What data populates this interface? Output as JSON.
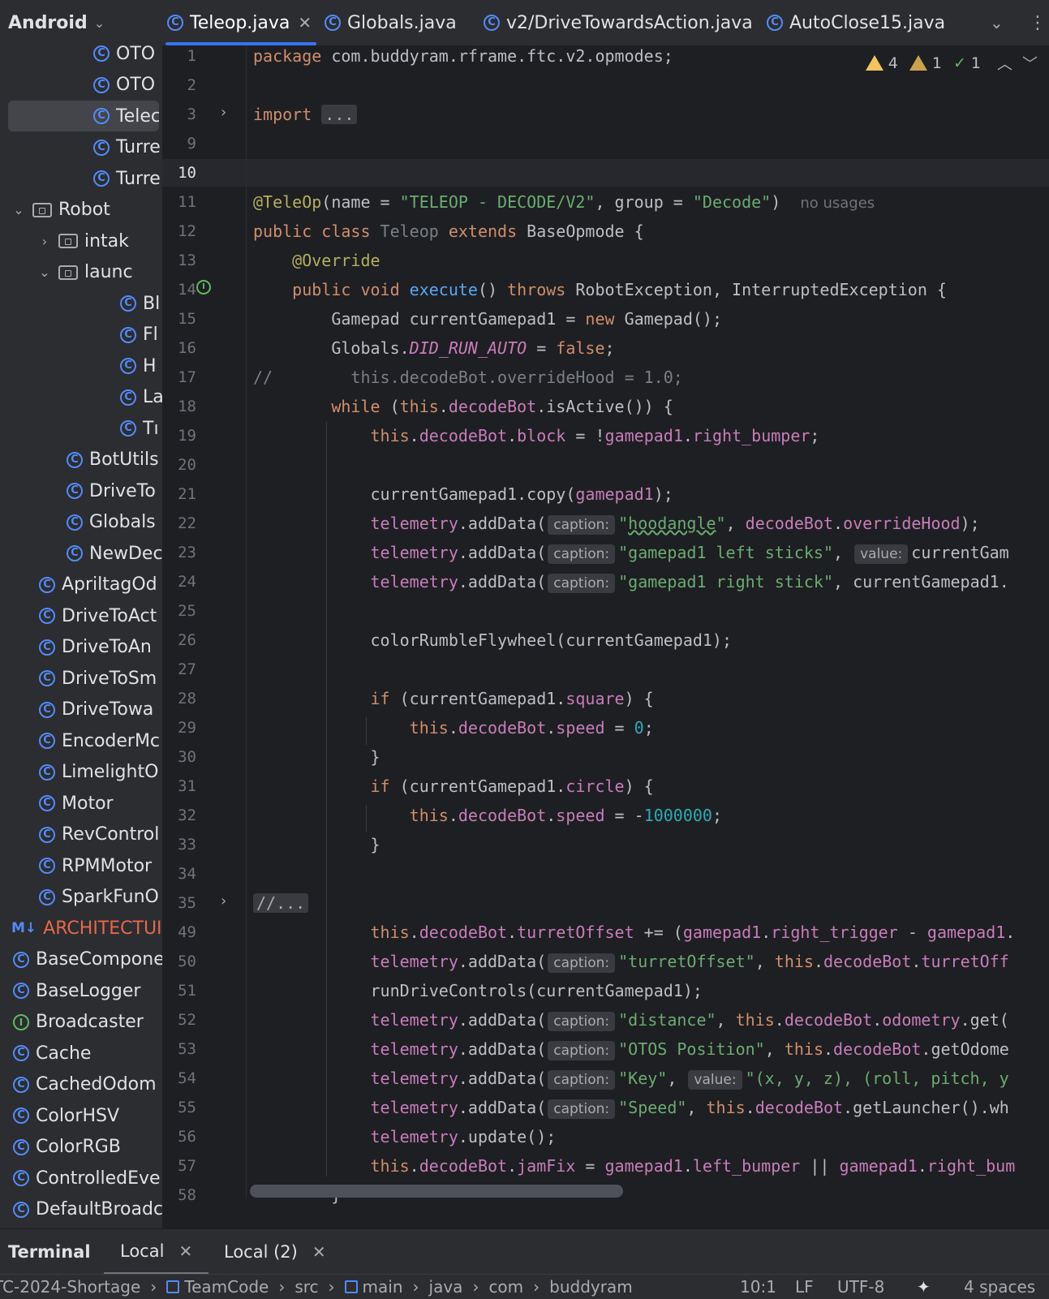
{
  "project_view": {
    "title": "Android",
    "items": [
      {
        "kind": "class",
        "label": "OTO",
        "indent": 115,
        "arrow": ""
      },
      {
        "kind": "class",
        "label": "OTO",
        "indent": 115,
        "arrow": ""
      },
      {
        "kind": "class",
        "label": "Telec",
        "indent": 115,
        "arrow": "",
        "selected": true
      },
      {
        "kind": "class",
        "label": "Turre",
        "indent": 115,
        "arrow": ""
      },
      {
        "kind": "class",
        "label": "Turre",
        "indent": 115,
        "arrow": ""
      },
      {
        "kind": "folder",
        "label": "Robot",
        "indent": 48,
        "arrow": "⌄"
      },
      {
        "kind": "folder",
        "label": "intak",
        "indent": 80,
        "arrow": "›"
      },
      {
        "kind": "folder",
        "label": "launc",
        "indent": 80,
        "arrow": "⌄"
      },
      {
        "kind": "class",
        "label": "Bl",
        "indent": 148,
        "arrow": ""
      },
      {
        "kind": "class",
        "label": "Fl",
        "indent": 148,
        "arrow": ""
      },
      {
        "kind": "class",
        "label": "H",
        "indent": 148,
        "arrow": ""
      },
      {
        "kind": "class",
        "label": "La",
        "indent": 148,
        "arrow": ""
      },
      {
        "kind": "class",
        "label": "Tı",
        "indent": 148,
        "arrow": ""
      },
      {
        "kind": "class",
        "label": "BotUtils",
        "indent": 82,
        "arrow": ""
      },
      {
        "kind": "class",
        "label": "DriveTo",
        "indent": 82,
        "arrow": ""
      },
      {
        "kind": "class",
        "label": "Globals",
        "indent": 82,
        "arrow": ""
      },
      {
        "kind": "class",
        "label": "NewDec",
        "indent": 82,
        "arrow": ""
      },
      {
        "kind": "class",
        "label": "ApriltagOd",
        "indent": 48,
        "arrow": ""
      },
      {
        "kind": "class",
        "label": "DriveToAct",
        "indent": 48,
        "arrow": ""
      },
      {
        "kind": "class",
        "label": "DriveToAn",
        "indent": 48,
        "arrow": ""
      },
      {
        "kind": "class",
        "label": "DriveToSm",
        "indent": 48,
        "arrow": ""
      },
      {
        "kind": "class",
        "label": "DriveTowa",
        "indent": 48,
        "arrow": ""
      },
      {
        "kind": "class",
        "label": "EncoderMc",
        "indent": 48,
        "arrow": ""
      },
      {
        "kind": "class",
        "label": "LimelightO",
        "indent": 48,
        "arrow": ""
      },
      {
        "kind": "class",
        "label": "Motor",
        "indent": 48,
        "arrow": ""
      },
      {
        "kind": "class",
        "label": "RevControl",
        "indent": 48,
        "arrow": ""
      },
      {
        "kind": "class",
        "label": "RPMMotor",
        "indent": 48,
        "arrow": ""
      },
      {
        "kind": "class",
        "label": "SparkFunO",
        "indent": 48,
        "arrow": ""
      },
      {
        "kind": "markdown",
        "label": "ARCHITECTUI",
        "indent": 14,
        "arrow": ""
      },
      {
        "kind": "class",
        "label": "BaseCompone",
        "indent": 16,
        "arrow": ""
      },
      {
        "kind": "class",
        "label": "BaseLogger",
        "indent": 16,
        "arrow": ""
      },
      {
        "kind": "interface",
        "label": "Broadcaster",
        "indent": 16,
        "arrow": ""
      },
      {
        "kind": "class",
        "label": "Cache",
        "indent": 16,
        "arrow": ""
      },
      {
        "kind": "class",
        "label": "CachedOdom",
        "indent": 16,
        "arrow": ""
      },
      {
        "kind": "class",
        "label": "ColorHSV",
        "indent": 16,
        "arrow": ""
      },
      {
        "kind": "class",
        "label": "ColorRGB",
        "indent": 16,
        "arrow": ""
      },
      {
        "kind": "class",
        "label": "ControlledEve",
        "indent": 16,
        "arrow": ""
      },
      {
        "kind": "class",
        "label": "DefaultBroadc",
        "indent": 16,
        "arrow": ""
      }
    ]
  },
  "tabs": [
    {
      "label": "Teleop.java",
      "active": true,
      "closable": true
    },
    {
      "label": "Globals.java",
      "active": false
    },
    {
      "label": "v2/DriveTowardsAction.java",
      "active": false
    },
    {
      "label": "AutoClose15.java",
      "active": false
    }
  ],
  "inspections": {
    "warnings": "4",
    "weak_warnings": "1",
    "ok": "1"
  },
  "hint_labels": {
    "caption": "caption:",
    "value": "value:"
  },
  "no_usages": "no usages",
  "line_numbers": [
    "1",
    "2",
    "3",
    "9",
    "10",
    "11",
    "12",
    "13",
    "14",
    "15",
    "16",
    "17",
    "18",
    "19",
    "20",
    "21",
    "22",
    "23",
    "24",
    "25",
    "26",
    "27",
    "28",
    "29",
    "30",
    "31",
    "32",
    "33",
    "34",
    "35",
    "49",
    "50",
    "51",
    "52",
    "53",
    "54",
    "55",
    "56",
    "57",
    "58"
  ],
  "code": {
    "l1_pkg": "package",
    "l1_name": " com.buddyram.rframe.ftc.v2.opmodes;",
    "l3_import": "import",
    "l3_fold": "...",
    "l11_ann": "@TeleOp",
    "l11_a": "(name = ",
    "l11_s1": "\"TELEOP - DECODE/V2\"",
    "l11_b": ", group = ",
    "l11_s2": "\"Decode\"",
    "l11_c": ")",
    "l12_kw1": "public class ",
    "l12_name": "Teleop",
    "l12_kw2": " extends ",
    "l12_rest": "BaseOpmode {",
    "l13_ann": "@Override",
    "l14_kw": "public void ",
    "l14_fn": "execute",
    "l14_a": "() ",
    "l14_kw2": "throws ",
    "l14_rest": "RobotException, InterruptedException {",
    "l15_a": "Gamepad currentGamepad1 = ",
    "l15_kw": "new ",
    "l15_b": "Gamepad();",
    "l16_a": "Globals.",
    "l16_st": "DID_RUN_AUTO",
    "l16_b": " = ",
    "l16_kw": "false",
    "l16_c": ";",
    "l17_cm": "//",
    "l17_text": "this.decodeBot.overrideHood = 1.0;",
    "l18_kw": "while ",
    "l18_a": "(",
    "l18_kw2": "this",
    "l18_b": ".",
    "l18_f": "decodeBot",
    "l18_c": ".isActive()) {",
    "l19_kw": "this",
    "l19_a": ".",
    "l19_f1": "decodeBot",
    "l19_b": ".",
    "l19_f2": "block",
    "l19_c": " = !",
    "l19_f3": "gamepad1",
    "l19_d": ".",
    "l19_f4": "right_bumper",
    "l19_e": ";",
    "l21_a": "currentGamepad1.copy(",
    "l21_f": "gamepad1",
    "l21_b": ");",
    "tele": "telemetry",
    "add": ".addData(",
    "l22_s": "\"hoodangle\"",
    "l22_s_word": "hoodangle",
    "l22_a": ", ",
    "l22_f1": "decodeBot",
    "l22_b": ".",
    "l22_f2": "overrideHood",
    "l22_c": ");",
    "l23_s": "\"gamepad1 left sticks\"",
    "l23_a": ", ",
    "l23_rest": "currentGam",
    "l24_s": "\"gamepad1 right stick\"",
    "l24_rest": ", currentGamepad1.",
    "l26": "colorRumbleFlywheel(currentGamepad1);",
    "l28_kw": "if ",
    "l28_a": "(currentGamepad1.",
    "l28_f": "square",
    "l28_b": ") {",
    "l29_kw": "this",
    "l29_a": ".",
    "l29_f1": "decodeBot",
    "l29_b": ".",
    "l29_f2": "speed",
    "l29_c": " = ",
    "l29_n": "0",
    "l29_d": ";",
    "brace": "}",
    "l31_f": "circle",
    "l32_c": " = -",
    "l32_n": "1000000",
    "l35_fold": "//...",
    "l49_f1": "decodeBot",
    "l49_f2": "turretOffset",
    "l49_a": " += (",
    "l49_f3": "gamepad1",
    "l49_f4": "right_trigger",
    "l49_b": " - ",
    "l49_f5": "gamepad1",
    "l50_s": "\"turretOffset\"",
    "l50_f2": "turretOff",
    "l51": "runDriveControls(currentGamepad1);",
    "l52_s": "\"distance\"",
    "l52_f2": "odometry",
    "l52_rest": ".get(",
    "l53_s": "\"OTOS Position\"",
    "l53_rest": ".getOdome",
    "l54_s": "\"Key\"",
    "l54_s2": "\"(x, y, z), (roll, pitch, y",
    "l55_s": "\"Speed\"",
    "l55_rest": ".getLauncher().wh",
    "l56_rest": ".update();",
    "l57_f2": "jamFix",
    "l57_a": " = ",
    "l57_f3": "left_bumper",
    "l57_b": " || ",
    "l57_f4": "right_bum",
    "l58": "}"
  },
  "terminal": {
    "title": "Terminal",
    "tabs": [
      "Local",
      "Local (2)"
    ]
  },
  "status_bar": {
    "breadcrumbs": [
      "TC-2024-Shortage",
      "TeamCode",
      "src",
      "main",
      "java",
      "com",
      "buddyram"
    ],
    "position": "10:1",
    "line_sep": "LF",
    "encoding": "UTF-8",
    "indent": "4 spaces"
  },
  "colors": {
    "accent": "#3574f0",
    "keyword": "#cf8e6d",
    "string": "#6aab73",
    "field": "#c77dbb",
    "number": "#2aacb8",
    "function": "#56a8f5",
    "annotation": "#b3ae60"
  }
}
